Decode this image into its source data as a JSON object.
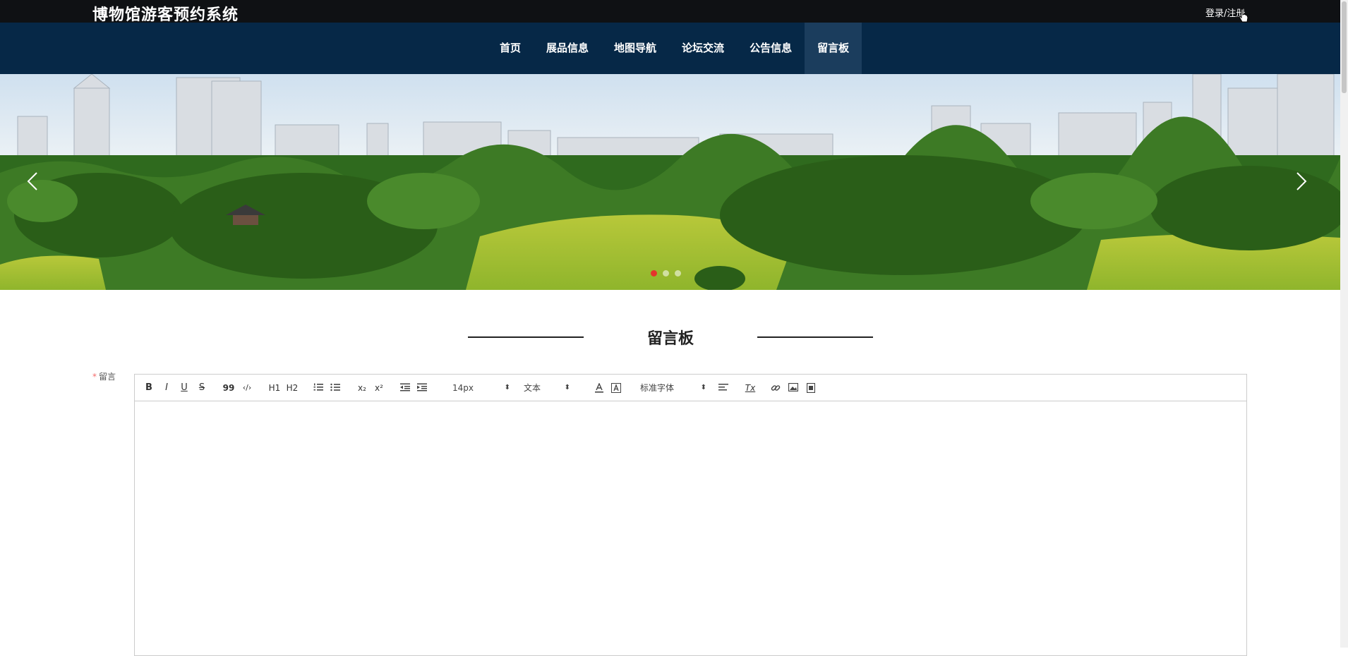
{
  "header": {
    "site_title": "博物馆游客预约系统",
    "login_label": "登录/注册"
  },
  "nav": {
    "items": [
      {
        "label": "首页"
      },
      {
        "label": "展品信息"
      },
      {
        "label": "地图导航"
      },
      {
        "label": "论坛交流"
      },
      {
        "label": "公告信息"
      },
      {
        "label": "留言板"
      }
    ],
    "active_index": 5
  },
  "banner": {
    "slide_count": 3,
    "active_slide": 0,
    "prev_icon": "chevron-left-icon",
    "next_icon": "chevron-right-icon"
  },
  "section": {
    "title": "留言板"
  },
  "form": {
    "message_label": "留言",
    "required_mark": "*",
    "editor": {
      "content": "",
      "toolbar": {
        "bold": "B",
        "italic": "I",
        "underline": "U",
        "strike": "S",
        "blockquote": "99",
        "code": "‹/›",
        "h1": "H1",
        "h2": "H2",
        "sub": "x₂",
        "sup": "x²",
        "font_size": "14px",
        "header_select": "文本",
        "font_family": "标准字体",
        "clean": "Tx"
      }
    }
  },
  "colors": {
    "topbar": "#0f1114",
    "nav": "#062847",
    "nav_active": "#1b3d5d",
    "dot_active": "#e5342c",
    "required": "#f56c6c"
  }
}
